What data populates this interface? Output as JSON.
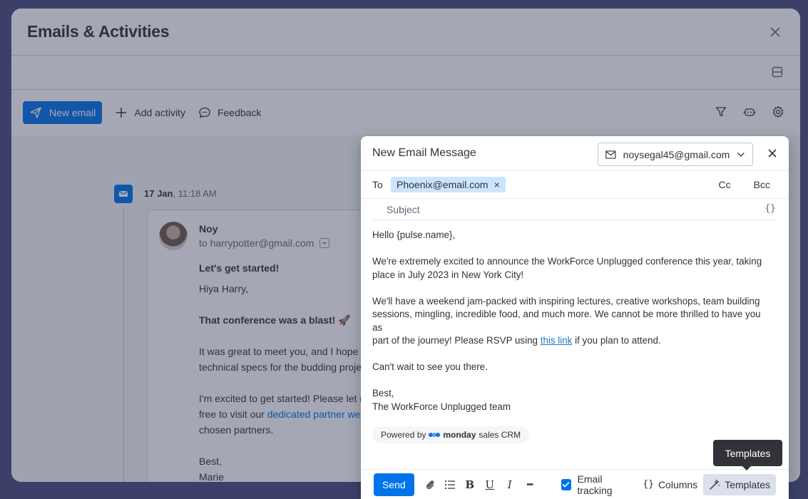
{
  "panel": {
    "title": "Emails & Activities"
  },
  "toolbar": {
    "new_email": "New email",
    "add_activity": "Add activity",
    "feedback": "Feedback"
  },
  "feed": {
    "date": "17 Jan",
    "time": ", 11:18 AM",
    "sender": "Noy",
    "recipient": "to harrypotter@gmail.com",
    "body": {
      "heading": "Let's get started!",
      "greeting": "Hiya Harry,",
      "bold_line": "That conference was a blast! 🚀",
      "p1_line1": "It was great to meet you, and I hope y",
      "p1_line2": "technical specs for the budding proje",
      "p2_line1": "I'm excited to get started! Please let m",
      "p2_line2_pre": "free to visit our ",
      "p2_line2_link": "dedicated partner we",
      "p2_line3": "chosen partners.",
      "signoff": "Best,",
      "name": "Marie"
    }
  },
  "compose": {
    "title": "New Email Message",
    "from_email": "noysegal45@gmail.com",
    "to_label": "To",
    "recipient_chip": "Phoenix@email.com",
    "chip_remove": "×",
    "cc": "Cc",
    "bcc": "Bcc",
    "subject_placeholder": "Subject",
    "var_button": "{}",
    "body": {
      "greeting": "Hello {pulse.name},",
      "p1_line1": "We're extremely excited to announce the WorkForce Unplugged conference this year, taking",
      "p1_line2": "place in July 2023 in New York City!",
      "p2_line1": "We'll have a weekend jam-packed with inspiring lectures, creative workshops, team building",
      "p2_line2": "sessions, mingling, incredible food, and much more. We cannot be more thrilled to have you as",
      "p2_line3_pre": "part of the journey! Please RSVP using ",
      "p2_line3_link": "this link",
      "p2_line3_post": " if you plan to attend.",
      "p3": "Can't wait to see you there.",
      "signoff": "Best,",
      "team": "The WorkForce Unplugged team"
    },
    "powered": {
      "prefix": "Powered by",
      "brand": "monday",
      "suffix": "sales CRM"
    },
    "toolbar": {
      "send": "Send",
      "bold": "B",
      "underline": "U",
      "italic": "I",
      "more": "•••",
      "email_tracking": "Email tracking",
      "columns_icon": "{}",
      "columns": "Columns",
      "templates": "Templates"
    }
  },
  "tooltip": {
    "text": "Templates"
  },
  "colors": {
    "primary": "#0073ea",
    "chip": "#cce5ff",
    "tooltip": "#323338"
  }
}
